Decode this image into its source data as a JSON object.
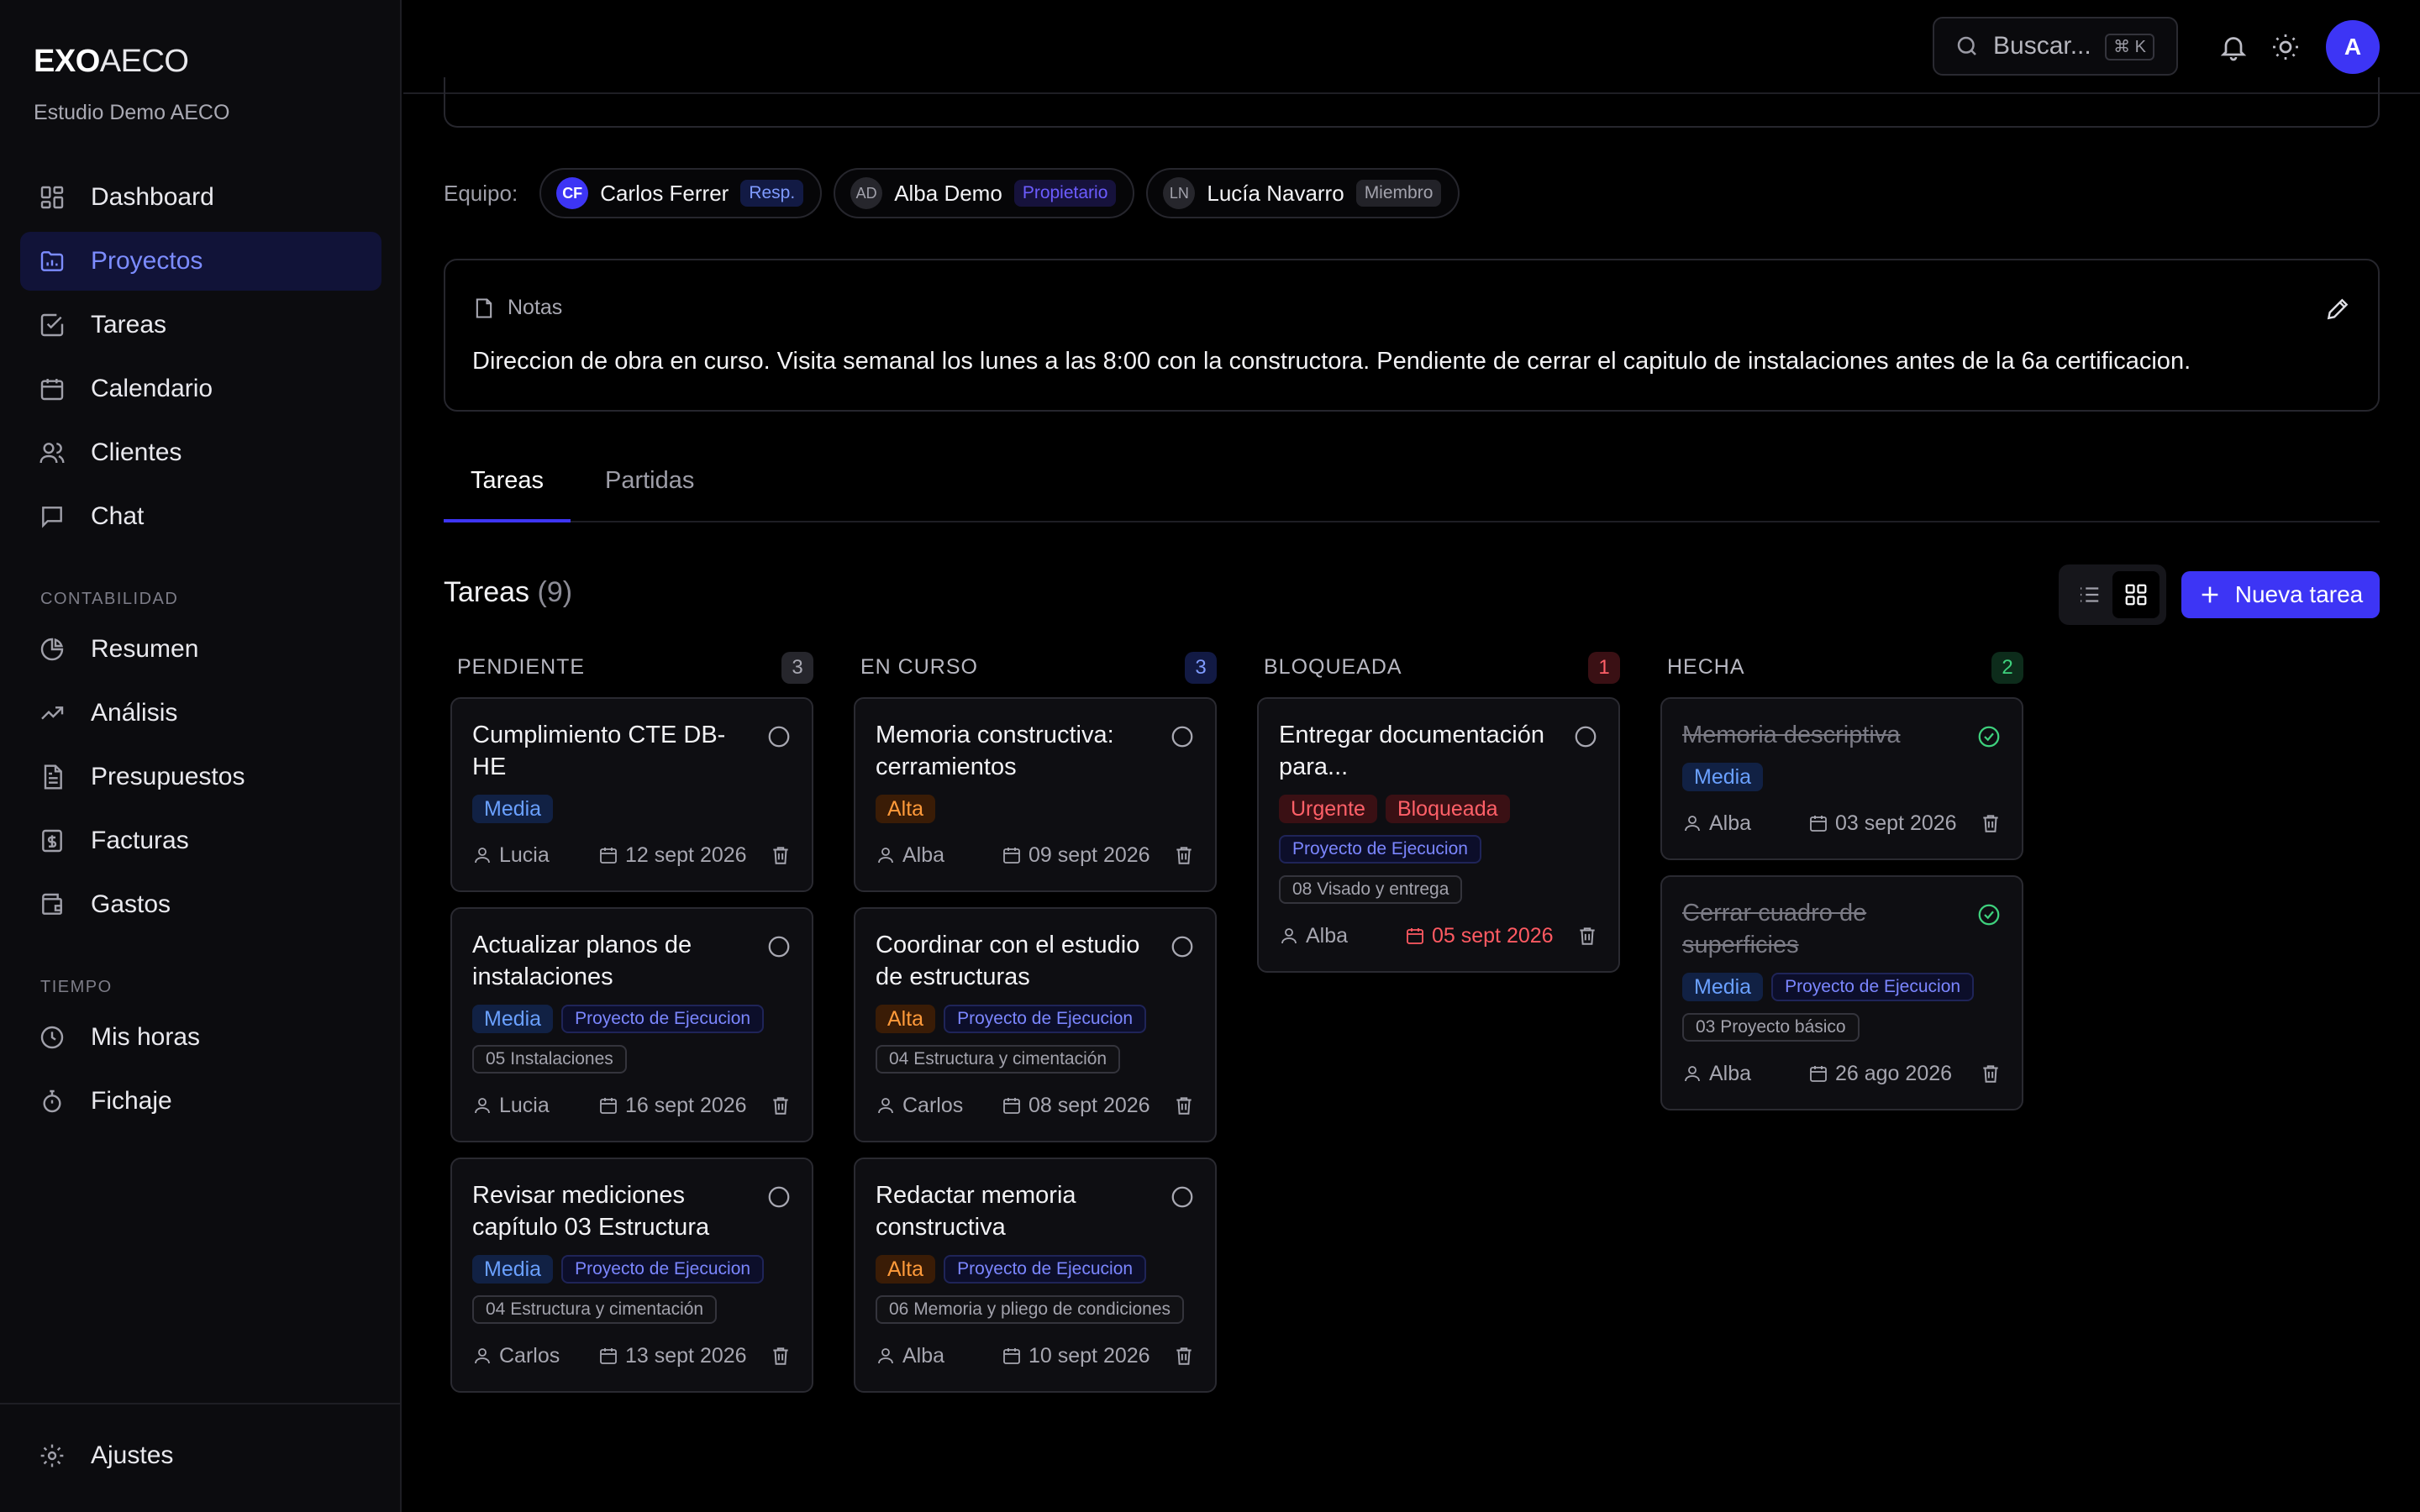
{
  "brand": {
    "bold": "EXO",
    "light": "AECO",
    "org": "Estudio Demo AECO"
  },
  "sidebar": {
    "items": [
      {
        "label": "Dashboard",
        "icon": "dashboard-icon"
      },
      {
        "label": "Proyectos",
        "icon": "folder-chart-icon",
        "active": true
      },
      {
        "label": "Tareas",
        "icon": "checkbox-icon"
      },
      {
        "label": "Calendario",
        "icon": "calendar-icon"
      },
      {
        "label": "Clientes",
        "icon": "users-icon"
      },
      {
        "label": "Chat",
        "icon": "chat-icon"
      }
    ],
    "section_contabilidad": "CONTABILIDAD",
    "contabilidad": [
      {
        "label": "Resumen",
        "icon": "pie-icon"
      },
      {
        "label": "Análisis",
        "icon": "trend-icon"
      },
      {
        "label": "Presupuestos",
        "icon": "document-icon"
      },
      {
        "label": "Facturas",
        "icon": "invoice-icon"
      },
      {
        "label": "Gastos",
        "icon": "wallet-icon"
      }
    ],
    "section_tiempo": "TIEMPO",
    "tiempo": [
      {
        "label": "Mis horas",
        "icon": "clock-icon"
      },
      {
        "label": "Fichaje",
        "icon": "stopwatch-icon"
      }
    ],
    "footer": {
      "label": "Ajustes",
      "icon": "gear-icon"
    }
  },
  "header": {
    "search_placeholder": "Buscar...",
    "shortcut": "⌘ K",
    "avatar_initial": "A"
  },
  "team": {
    "label": "Equipo:",
    "members": [
      {
        "initials": "CF",
        "name": "Carlos Ferrer",
        "role": "Resp."
      },
      {
        "initials": "AD",
        "name": "Alba Demo",
        "role": "Propietario"
      },
      {
        "initials": "LN",
        "name": "Lucía Navarro",
        "role": "Miembro"
      }
    ]
  },
  "notes": {
    "title": "Notas",
    "text": "Direccion de obra en curso. Visita semanal los lunes a las 8:00 con la constructora. Pendiente de cerrar el capitulo de instalaciones antes de la 6a certificacion."
  },
  "tabs": [
    "Tareas",
    "Partidas"
  ],
  "tasks": {
    "title": "Tareas",
    "count": "(9)",
    "new_button": "Nueva tarea"
  },
  "columns": [
    {
      "title": "PENDIENTE",
      "count": "3",
      "cards": [
        {
          "title": "Cumplimiento CTE DB-HE",
          "priority": "Media",
          "user": "Lucia",
          "date": "12 sept 2026"
        },
        {
          "title": "Actualizar planos de instalaciones",
          "priority": "Media",
          "project": "Proyecto de Ejecucion",
          "partida": "05 Instalaciones",
          "user": "Lucia",
          "date": "16 sept 2026"
        },
        {
          "title": "Revisar mediciones capítulo 03 Estructura",
          "priority": "Media",
          "project": "Proyecto de Ejecucion",
          "partida": "04 Estructura y cimentación",
          "user": "Carlos",
          "date": "13 sept 2026"
        }
      ]
    },
    {
      "title": "EN CURSO",
      "count": "3",
      "cards": [
        {
          "title": "Memoria constructiva: cerramientos",
          "priority": "Alta",
          "user": "Alba",
          "date": "09 sept 2026"
        },
        {
          "title": "Coordinar con el estudio de estructuras",
          "priority": "Alta",
          "project": "Proyecto de Ejecucion",
          "partida": "04 Estructura y cimentación",
          "user": "Carlos",
          "date": "08 sept 2026"
        },
        {
          "title": "Redactar memoria constructiva",
          "priority": "Alta",
          "project": "Proyecto de Ejecucion",
          "partida": "06 Memoria y pliego de condiciones",
          "user": "Alba",
          "date": "10 sept 2026"
        }
      ]
    },
    {
      "title": "BLOQUEADA",
      "count": "1",
      "cards": [
        {
          "title": "Entregar documentación para...",
          "priority": "Urgente",
          "status_tag": "Bloqueada",
          "project": "Proyecto de Ejecucion",
          "partida": "08 Visado y entrega",
          "user": "Alba",
          "date": "05 sept 2026"
        }
      ]
    },
    {
      "title": "HECHA",
      "count": "2",
      "cards": [
        {
          "title": "Memoria descriptiva",
          "priority": "Media",
          "user": "Alba",
          "date": "03 sept 2026"
        },
        {
          "title": "Cerrar cuadro de superficies",
          "priority": "Media",
          "project": "Proyecto de Ejecucion",
          "partida": "03 Proyecto básico",
          "user": "Alba",
          "date": "26 ago 2026"
        }
      ]
    }
  ],
  "colors": {
    "accent": "#3d35f5",
    "media": "#6aa0ff",
    "alta": "#ff9a3a",
    "urgente": "#ff6068",
    "done": "#3ed17d"
  }
}
